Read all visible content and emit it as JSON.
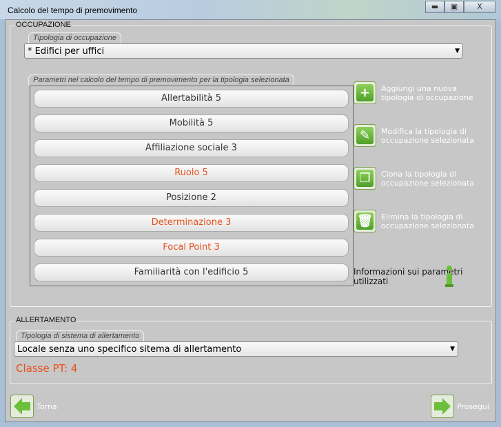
{
  "window": {
    "title": "Calcolo del tempo di premovimento",
    "minimize": "▬",
    "maximize": "▣",
    "close": "X"
  },
  "occupazione": {
    "group_label": "OCCUPAZIONE",
    "tipologia_label": "Tipologia di occupazione",
    "tipologia_value": "* Edifici per uffici",
    "params_label": "Parametri nel calcolo del tempo di premovimento per la tipologia selezionata",
    "params": [
      {
        "label": "Allertabilità 5",
        "highlight": false
      },
      {
        "label": "Mobilità 5",
        "highlight": false
      },
      {
        "label": "Affiliazione sociale 3",
        "highlight": false
      },
      {
        "label": "Ruolo 5",
        "highlight": true
      },
      {
        "label": "Posizione 2",
        "highlight": false
      },
      {
        "label": "Determinazione 3",
        "highlight": true
      },
      {
        "label": "Focal Point 3",
        "highlight": true
      },
      {
        "label": "Familiarità con l'edificio 5",
        "highlight": false
      }
    ],
    "actions": [
      {
        "icon": "plus-icon",
        "label": "Aggiungi una nuova tipologia di occupazione"
      },
      {
        "icon": "pencil-icon",
        "label": "Modifica la tipologia di occupazione selezionata"
      },
      {
        "icon": "clone-icon",
        "label": "Clona la tipologia di occupazione selezionata"
      },
      {
        "icon": "trash-icon",
        "label": "Elimina la tipologia di occupazione selezionata"
      }
    ],
    "info_label": "Informazioni sui parametri utilizzati"
  },
  "allertamento": {
    "group_label": "ALLERTAMENTO",
    "tipologia_label": "Tipologia di sistema di allertamento",
    "tipologia_value": "Locale senza uno specifico sitema di allertamento",
    "classe": "Classe PT: 4"
  },
  "nav": {
    "back": "Torna",
    "next": "Prosegui"
  },
  "colors": {
    "highlight": "#e8501e",
    "accent_green": "#5cb030",
    "panel": "#c7c7c7"
  }
}
